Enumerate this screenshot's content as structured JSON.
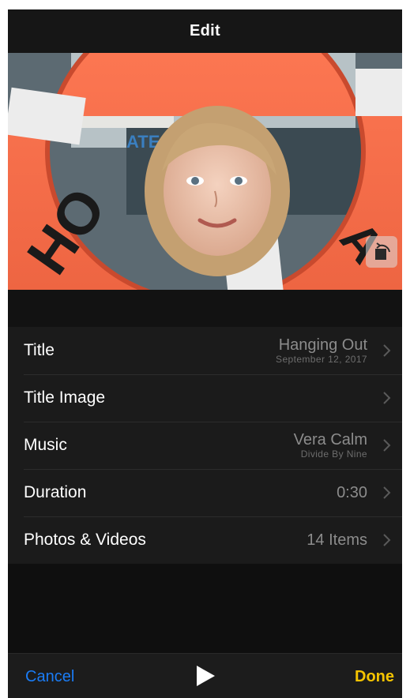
{
  "navbar": {
    "title": "Edit"
  },
  "preview": {
    "image": "girl-in-life-ring-photo"
  },
  "settings": [
    {
      "label": "Title",
      "value": "Hanging Out",
      "sub": "September 12, 2017"
    },
    {
      "label": "Title Image",
      "value": "",
      "sub": ""
    },
    {
      "label": "Music",
      "value": "Vera Calm",
      "sub": "Divide By Nine"
    },
    {
      "label": "Duration",
      "value": "0:30",
      "sub": ""
    },
    {
      "label": "Photos & Videos",
      "value": "14 Items",
      "sub": ""
    }
  ],
  "toolbar": {
    "cancel_label": "Cancel",
    "done_label": "Done",
    "play_icon": "play-icon"
  },
  "colors": {
    "accent_blue": "#1a7cf5",
    "done_yellow": "#f5c400",
    "background": "#0f0f0f"
  }
}
